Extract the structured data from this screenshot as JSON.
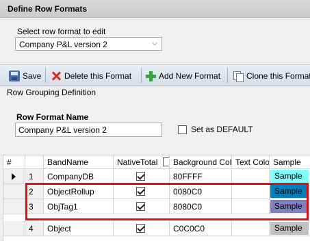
{
  "window": {
    "title": "Define Row Formats"
  },
  "selector": {
    "label": "Select row format to edit",
    "value": "Company P&L version 2"
  },
  "toolbar": {
    "save_label": "Save",
    "delete_label": "Delete this Format",
    "add_label": "Add New Format",
    "clone_label": "Clone this Format"
  },
  "grouping": {
    "label": "Row Grouping Definition"
  },
  "format": {
    "name_label": "Row Format Name",
    "name_value": "Company P&L version 2",
    "default_label": "Set as DEFAULT",
    "default_checked": false
  },
  "grid": {
    "columns": [
      "#",
      "BandName",
      "NativeTotal",
      "Background Color",
      "Text Color",
      "Sample"
    ],
    "rows": [
      {
        "index": "1",
        "band": "CompanyDB",
        "native_total": true,
        "bg": "80FFFF",
        "text_color": "",
        "sample": "Sample",
        "swatch": "#80ffff",
        "current": true
      },
      {
        "index": "2",
        "band": "ObjectRollup",
        "native_total": true,
        "bg": "0080C0",
        "text_color": "",
        "sample": "Sample",
        "swatch": "#0080c0",
        "current": false
      },
      {
        "index": "3",
        "band": "ObjTag1",
        "native_total": true,
        "bg": "8080C0",
        "text_color": "",
        "sample": "Sample",
        "swatch": "#8080c0",
        "current": false
      },
      {
        "index": "4",
        "band": "Object",
        "native_total": true,
        "bg": "C0C0C0",
        "text_color": "",
        "sample": "Sample",
        "swatch": "#c0c0c0",
        "current": false
      }
    ]
  },
  "colors": {
    "highlight": "#e01010",
    "toolbar_bg": "#dfe5ee"
  }
}
